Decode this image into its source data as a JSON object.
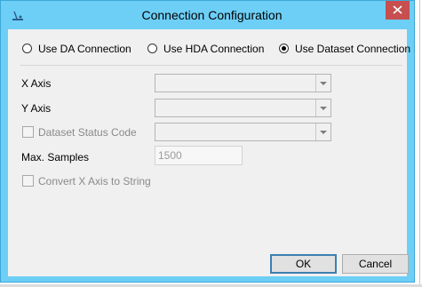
{
  "window": {
    "title": "Connection Configuration"
  },
  "connection_type": {
    "options": [
      {
        "label": "Use DA Connection",
        "selected": false
      },
      {
        "label": "Use HDA Connection",
        "selected": false
      },
      {
        "label": "Use Dataset Connection",
        "selected": true
      }
    ]
  },
  "fields": {
    "x_axis_label": "X Axis",
    "x_axis_value": "",
    "y_axis_label": "Y Axis",
    "y_axis_value": "",
    "dataset_status_label": "Dataset Status Code",
    "dataset_status_checked": false,
    "dataset_status_value": "",
    "max_samples_label": "Max. Samples",
    "max_samples_value": "1500",
    "convert_label": "Convert X Axis to String",
    "convert_checked": false
  },
  "buttons": {
    "ok": "OK",
    "cancel": "Cancel"
  },
  "colors": {
    "titlebar": "#6dcff6",
    "close_button": "#c74f4f",
    "client_background": "#f0f0f0",
    "default_button_border": "#3c7fb1"
  },
  "icons": {
    "app": "app-icon",
    "close": "close-icon",
    "dropdown": "chevron-down-icon"
  }
}
